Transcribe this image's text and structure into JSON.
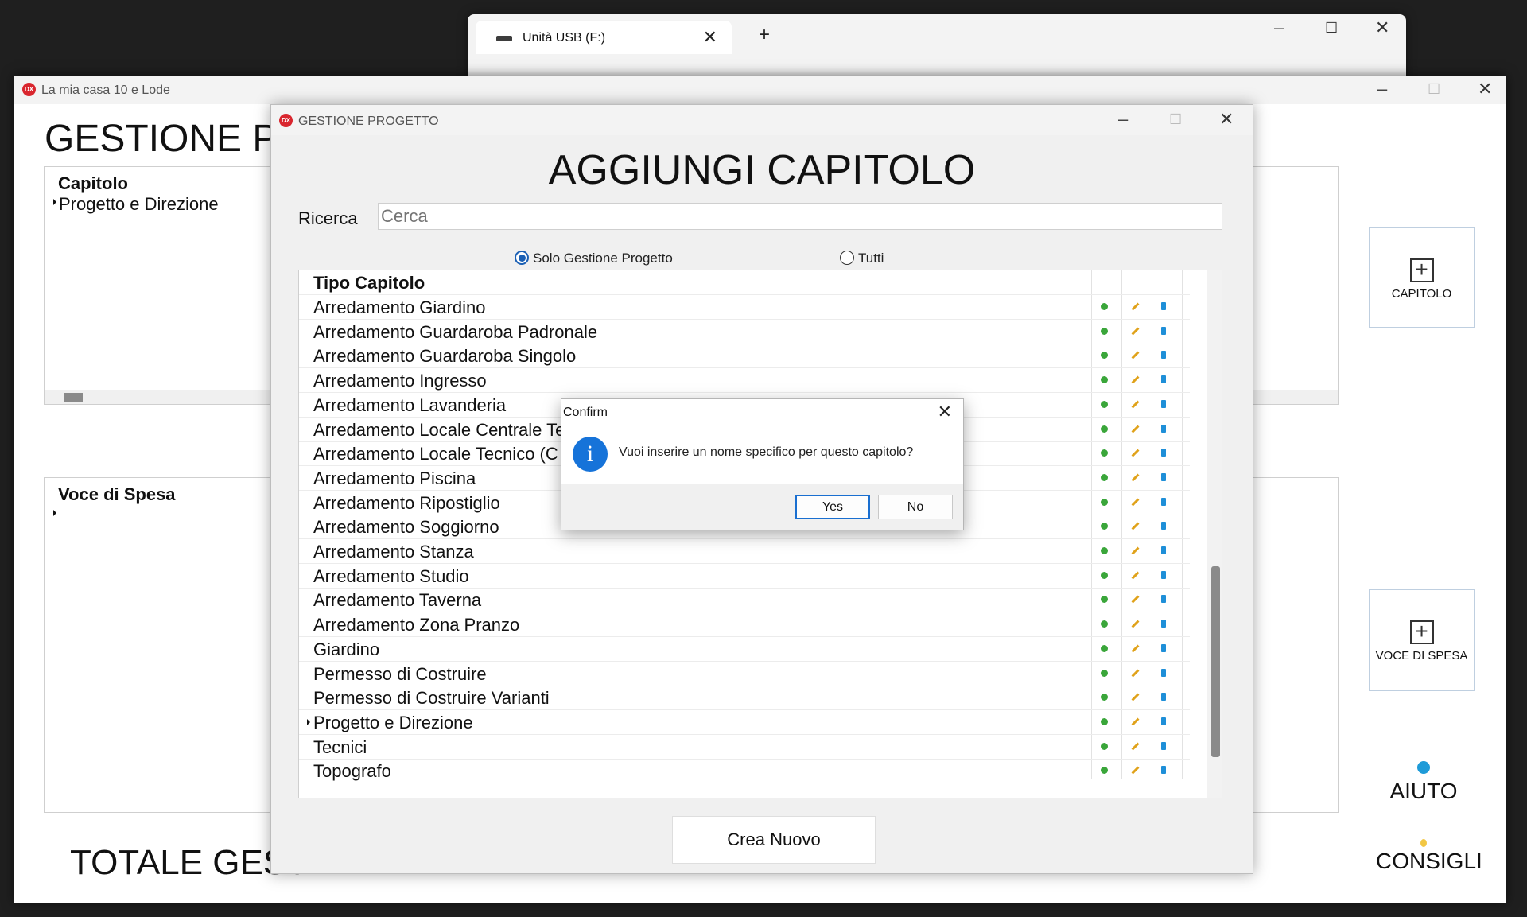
{
  "explorer": {
    "tab_title": "Unità USB (F:)",
    "close_glyph": "✕",
    "new_tab_glyph": "+"
  },
  "main_window": {
    "title": "La mia casa 10 e Lode",
    "logo": "DX",
    "heading": "GESTIONE PR",
    "chapter_grid": {
      "header": "Capitolo",
      "rows": [
        "Progetto e Direzione"
      ]
    },
    "expense_grid": {
      "header": "Voce di Spesa"
    },
    "buttons": {
      "capitolo": "CAPITOLO",
      "voce_spesa": "VOCE DI SPESA",
      "aiuto": "AIUTO",
      "consigli": "CONSIGLI"
    },
    "total": "TOTALE GEST"
  },
  "project_window": {
    "title": "GESTIONE PROGETTO",
    "logo": "DX",
    "heading": "AGGIUNGI CAPITOLO",
    "search": {
      "label": "Ricerca",
      "placeholder": "Cerca"
    },
    "filter": {
      "option_solo": "Solo Gestione Progetto",
      "option_tutti": "Tutti",
      "selected": "Solo Gestione Progetto"
    },
    "grid_header": "Tipo Capitolo",
    "chapters": [
      "Arredamento Giardino",
      "Arredamento Guardaroba Padronale",
      "Arredamento Guardaroba Singolo",
      "Arredamento Ingresso",
      "Arredamento Lavanderia",
      "Arredamento Locale Centrale Te",
      "Arredamento Locale Tecnico (C",
      "Arredamento Piscina",
      "Arredamento Ripostiglio",
      "Arredamento Soggiorno",
      "Arredamento Stanza",
      "Arredamento Studio",
      "Arredamento Taverna",
      "Arredamento Zona Pranzo",
      "Giardino",
      "Permesso di Costruire",
      "Permesso di Costruire Varianti",
      "Progetto e Direzione",
      "Tecnici",
      "Topografo"
    ],
    "current_row_index": 17,
    "create_button": "Crea Nuovo"
  },
  "confirm_dialog": {
    "title": "Confirm",
    "icon": "info-icon",
    "icon_glyph": "i",
    "message": "Vuoi inserire un nome specifico per questo capitolo?",
    "yes_label": "Yes",
    "no_label": "No",
    "default_button": "Yes"
  },
  "colors": {
    "accent": "#1a6fd0",
    "ok": "#3aa63a",
    "edit": "#e0a21a",
    "delete": "#1e8fd8",
    "logo": "#d9262e"
  }
}
